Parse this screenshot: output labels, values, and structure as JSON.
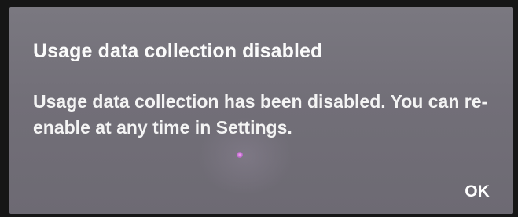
{
  "dialog": {
    "title": "Usage data collection disabled",
    "message": "Usage data collection has been disabled. You can re-enable at any time in Settings.",
    "ok_label": "OK"
  },
  "colors": {
    "dialog_background": "#75727b",
    "text": "#f8f8f8"
  }
}
